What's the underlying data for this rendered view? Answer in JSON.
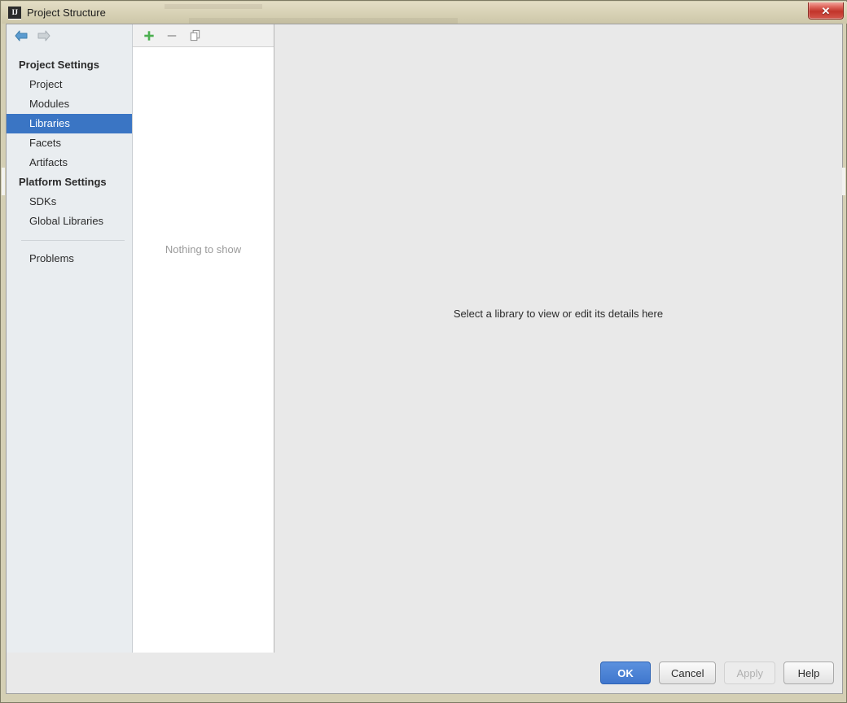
{
  "window": {
    "title": "Project Structure",
    "app_icon": "IJ",
    "close_icon": "✕"
  },
  "nav": {
    "back_icon": "back-arrow-icon",
    "forward_icon": "forward-arrow-icon",
    "back_color": "#6aa3cc",
    "forward_color": "#b6bdc2"
  },
  "sidebar": {
    "groups": [
      {
        "label": "Project Settings",
        "items": [
          {
            "label": "Project",
            "selected": false
          },
          {
            "label": "Modules",
            "selected": false
          },
          {
            "label": "Libraries",
            "selected": true
          },
          {
            "label": "Facets",
            "selected": false
          },
          {
            "label": "Artifacts",
            "selected": false
          }
        ]
      },
      {
        "label": "Platform Settings",
        "items": [
          {
            "label": "SDKs",
            "selected": false
          },
          {
            "label": "Global Libraries",
            "selected": false
          }
        ]
      }
    ],
    "extra_items": [
      {
        "label": "Problems"
      }
    ],
    "selected_color": "#3a75c4"
  },
  "list_panel": {
    "toolbar": [
      {
        "name": "add",
        "glyph": "＋",
        "color": "#4caf50",
        "enabled": true
      },
      {
        "name": "remove",
        "glyph": "−",
        "color": "#9a9a9a",
        "enabled": false
      },
      {
        "name": "copy",
        "glyph": "⧉",
        "color": "#8c8c8c",
        "enabled": true
      }
    ],
    "empty_text": "Nothing to show"
  },
  "detail_panel": {
    "message": "Select a library to view or edit its details here"
  },
  "buttons": [
    {
      "label": "OK",
      "style": "primary"
    },
    {
      "label": "Cancel",
      "style": "normal"
    },
    {
      "label": "Apply",
      "style": "disabled"
    },
    {
      "label": "Help",
      "style": "normal"
    }
  ]
}
